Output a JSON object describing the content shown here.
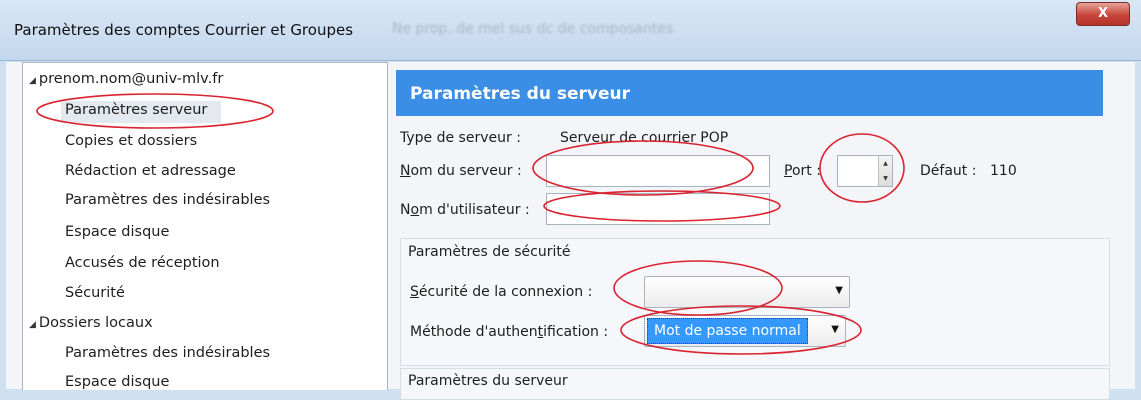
{
  "window": {
    "title": "Paramètres des comptes Courrier et Groupes",
    "faded_title_text": "Ne prop. de mel sus dc de composantes",
    "close_label": "X"
  },
  "tree": {
    "account": {
      "label": "prenom.nom@univ-mlv.fr",
      "expanded": true
    },
    "account_items": [
      "Paramètres serveur",
      "Copies et dossiers",
      "Rédaction et adressage",
      "Paramètres des indésirables",
      "Espace disque",
      "Accusés de réception",
      "Sécurité"
    ],
    "local": {
      "label": "Dossiers locaux",
      "expanded": true
    },
    "local_items": [
      "Paramètres des indésirables",
      "Espace disque"
    ],
    "selected": "Paramètres serveur"
  },
  "panel": {
    "header": "Paramètres du serveur",
    "server_type_label": "Type de serveur :",
    "server_type_value": "Serveur de courrier POP",
    "server_name": {
      "prefix": "N",
      "rest": "om du serveur :",
      "value": ""
    },
    "port": {
      "prefix": "P",
      "rest": "ort :",
      "value": ""
    },
    "default_label": "Défaut :",
    "default_value": "110",
    "username": {
      "pre": "N",
      "ul": "o",
      "rest": "m d'utilisateur :",
      "value": ""
    },
    "security_group": {
      "title": "Paramètres de sécurité",
      "connection": {
        "prefix": "S",
        "rest": "écurité de la connexion :",
        "value": ""
      },
      "auth": {
        "pre": "Méthode d'authen",
        "ul": "t",
        "rest": "ification :",
        "value": "Mot de passe normal"
      }
    },
    "server_group": {
      "title": "Paramètres du serveur"
    }
  },
  "colors": {
    "header_bg": "#3a8ee6",
    "annotation": "#d9232e",
    "selection": "#3399ff"
  }
}
